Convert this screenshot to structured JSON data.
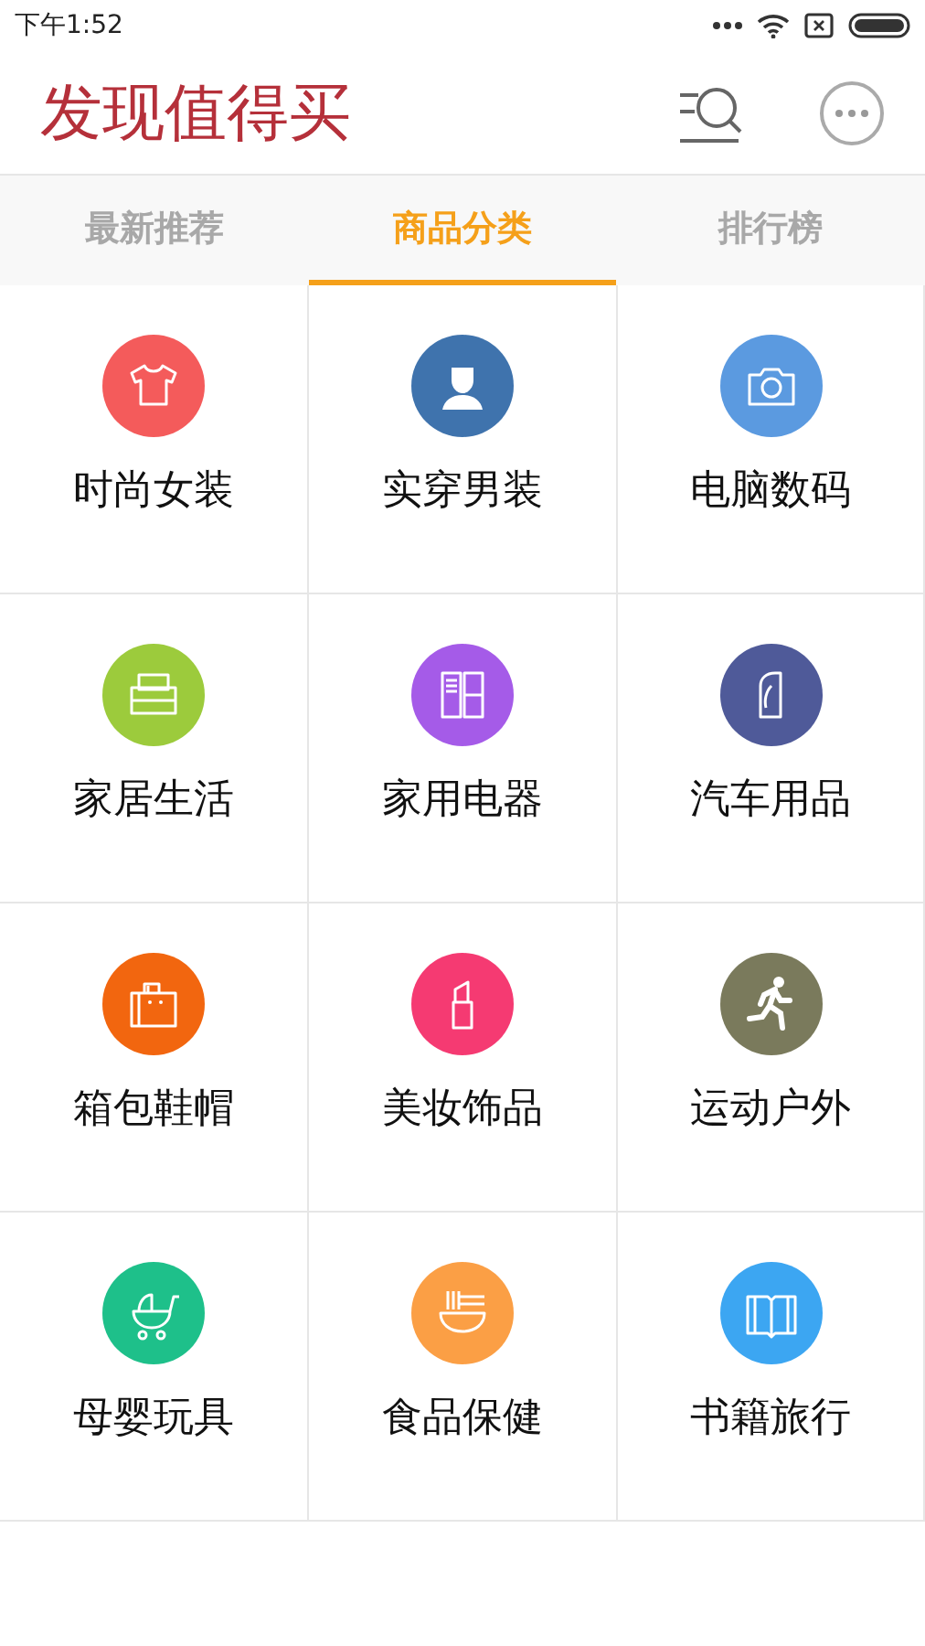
{
  "status_bar": {
    "time": "下午1:52"
  },
  "header": {
    "title": "发现值得买"
  },
  "tabs": [
    {
      "label": "最新推荐",
      "selected": false
    },
    {
      "label": "商品分类",
      "selected": true
    },
    {
      "label": "排行榜",
      "selected": false
    }
  ],
  "categories": [
    {
      "label": "时尚女装",
      "color": "#f45b5b"
    },
    {
      "label": "实穿男装",
      "color": "#3f73ad"
    },
    {
      "label": "电脑数码",
      "color": "#5b9ae0"
    },
    {
      "label": "家居生活",
      "color": "#9ccb3c"
    },
    {
      "label": "家用电器",
      "color": "#a55be8"
    },
    {
      "label": "汽车用品",
      "color": "#4f5a99"
    },
    {
      "label": "箱包鞋帽",
      "color": "#f2660f"
    },
    {
      "label": "美妆饰品",
      "color": "#f53a72"
    },
    {
      "label": "运动户外",
      "color": "#7a7a5c"
    },
    {
      "label": "母婴玩具",
      "color": "#1ec08a"
    },
    {
      "label": "食品保健",
      "color": "#fb9f45"
    },
    {
      "label": "书籍旅行",
      "color": "#3ca6f2"
    }
  ]
}
